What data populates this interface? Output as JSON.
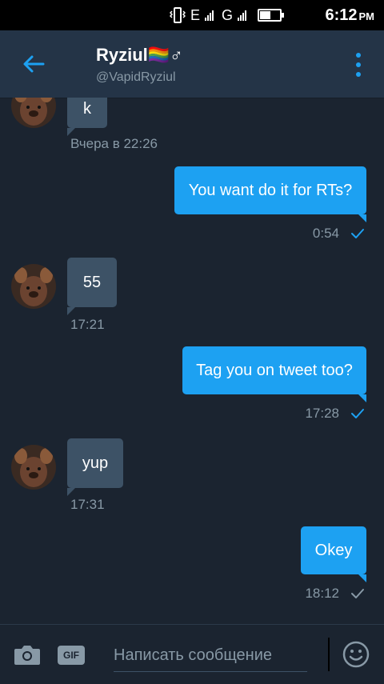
{
  "status_bar": {
    "network_e_label": "E",
    "network_g_label": "G",
    "battery_level": 0.6,
    "time": "6:12",
    "ampm": "PM"
  },
  "header": {
    "name": "Ryziul🏳️‍🌈♂",
    "handle": "@VapidRyziul",
    "back_icon": "arrow-left-icon",
    "menu_icon": "more-vertical-icon",
    "accent_color": "#1da1f2"
  },
  "messages": [
    {
      "direction": "in",
      "text": "k",
      "meta": "Вчера в 22:26"
    },
    {
      "direction": "out",
      "text": "You want do it for RTs?",
      "meta": "0:54",
      "status_icon": "check-icon"
    },
    {
      "direction": "in",
      "text": "55",
      "meta": "17:21"
    },
    {
      "direction": "out",
      "text": "Tag you on tweet too?",
      "meta": "17:28",
      "status_icon": "check-icon"
    },
    {
      "direction": "in",
      "text": "yup",
      "meta": "17:31"
    },
    {
      "direction": "out",
      "text": "Okey",
      "meta": "18:12",
      "status_icon": "check-icon"
    }
  ],
  "composer": {
    "camera_icon": "camera-icon",
    "gif_label": "GIF",
    "placeholder": "Написать сообщение",
    "value": "",
    "emoji_icon": "emoji-smile-icon"
  },
  "colors": {
    "background": "#1b2430",
    "header_bg": "#243447",
    "incoming_bubble": "#3d5266",
    "outgoing_bubble": "#1da1f2",
    "meta_text": "#8899a6"
  }
}
